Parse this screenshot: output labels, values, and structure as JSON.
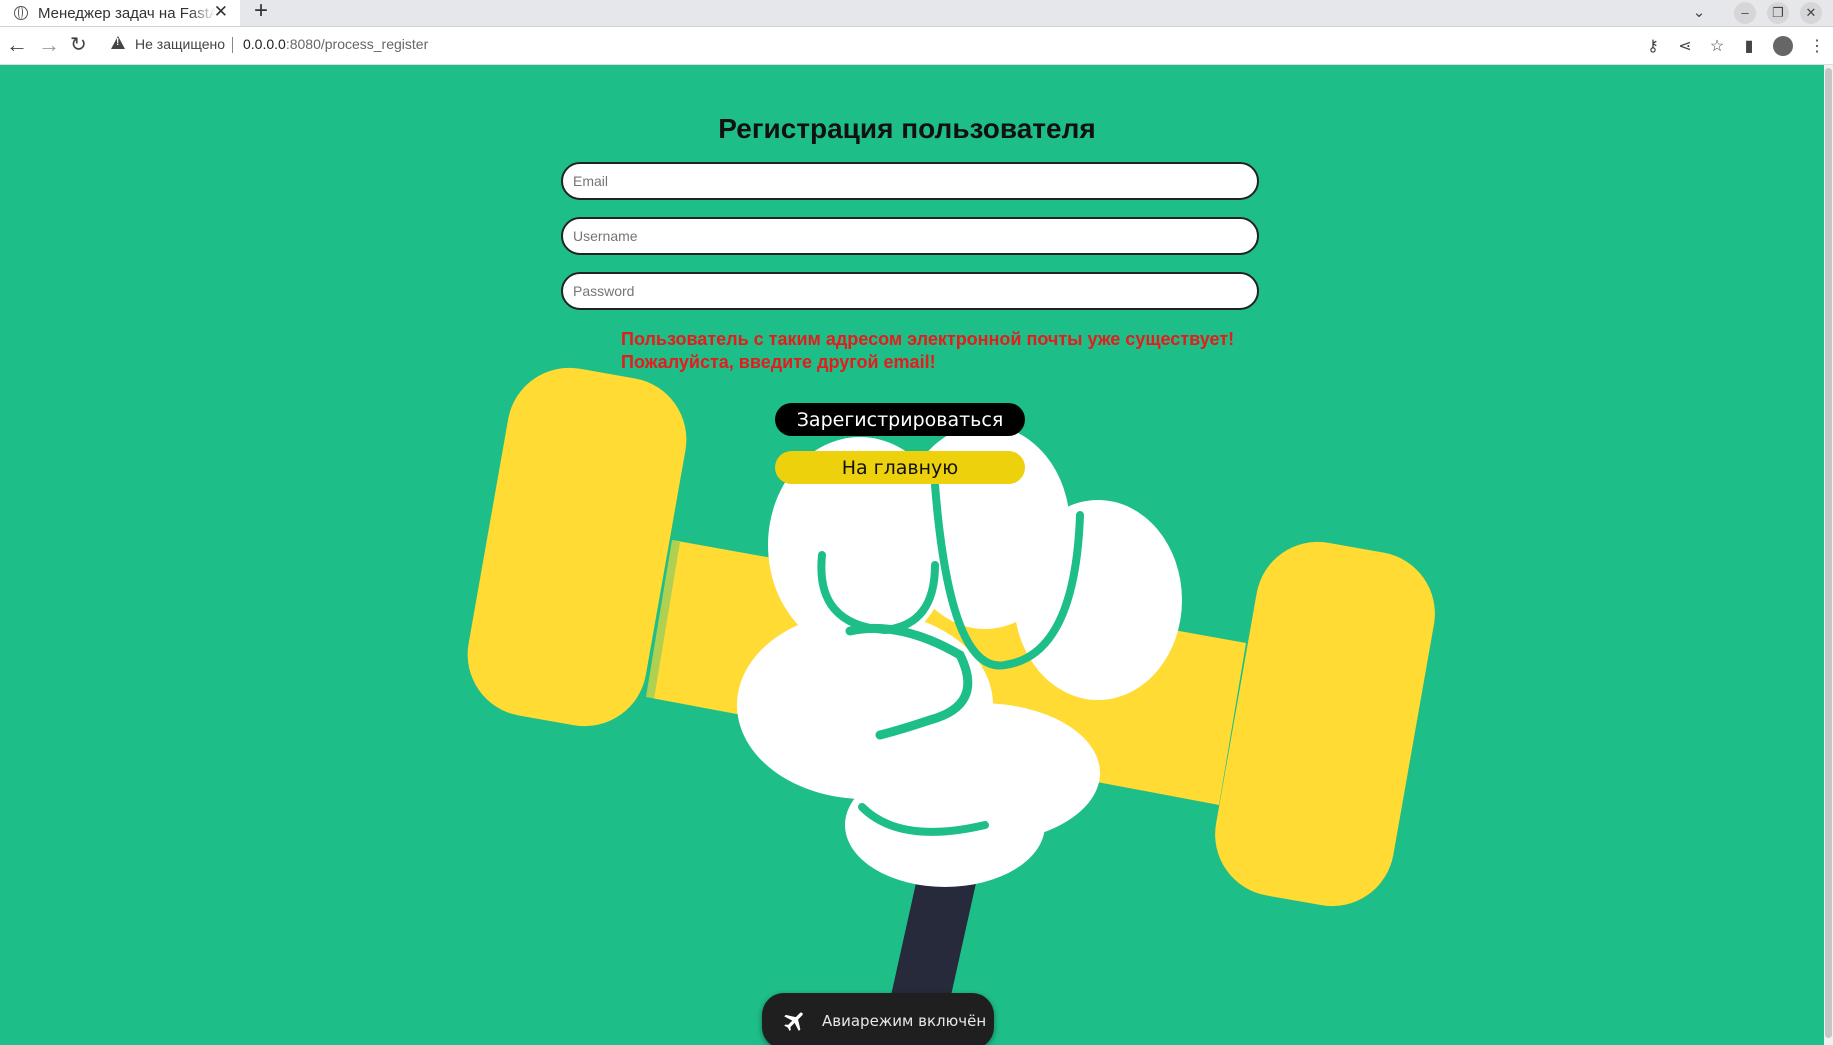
{
  "browser": {
    "tab_title": "Менеджер задач на FastAPI",
    "tab_close": "✕",
    "new_tab": "+",
    "security_label": "Не защищено",
    "url_host": "0.0.0.0",
    "url_rest": ":8080/process_register"
  },
  "form": {
    "title": "Регистрация пользователя",
    "email_placeholder": "Email",
    "username_placeholder": "Username",
    "password_placeholder": "Password",
    "error_line1": "Пользователь с таким адресом электронной почты уже существует!",
    "error_line2": "Пожалуйста, введите другой email!",
    "register_button": "Зарегистрироваться",
    "home_button": "На главную"
  },
  "toast": {
    "text": "Авиарежим включён"
  },
  "colors": {
    "background": "#1ebe89",
    "dumbbell": "#ffdb33",
    "error": "#e41c1c",
    "home_button": "#ecd10c"
  }
}
